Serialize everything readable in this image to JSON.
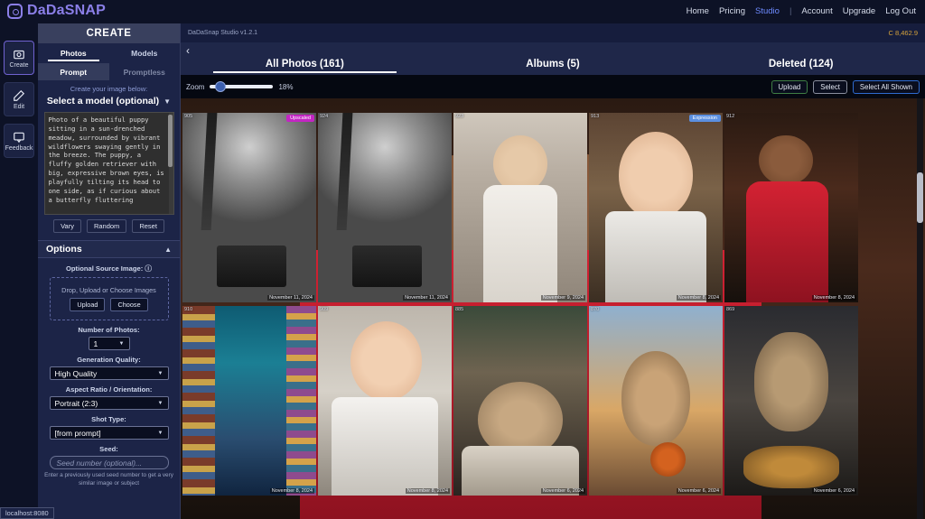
{
  "brand": {
    "name": "DaDaSNAP",
    "logo_icon": "camera-icon"
  },
  "topnav": {
    "items": [
      "Home",
      "Pricing",
      "Studio",
      "Account",
      "Upgrade",
      "Log Out"
    ],
    "active": "Studio",
    "separator": "|"
  },
  "rail": {
    "items": [
      {
        "label": "Create",
        "icon": "camera-icon",
        "selected": true
      },
      {
        "label": "Edit",
        "icon": "pencil-icon",
        "selected": false
      },
      {
        "label": "Feedback",
        "icon": "speech-bubble-icon",
        "selected": false
      }
    ]
  },
  "panel": {
    "title": "CREATE",
    "tabs": [
      {
        "label": "Photos",
        "active": true
      },
      {
        "label": "Models",
        "active": false
      }
    ],
    "subtabs": [
      {
        "label": "Prompt",
        "active": true
      },
      {
        "label": "Promptless",
        "active": false
      }
    ],
    "hint": "Create your image below:",
    "model_select": "Select a model (optional)",
    "model_chevron": "chevron-down-icon",
    "prompt_text": "Photo of a beautiful puppy sitting in a sun-drenched meadow, surrounded by vibrant wildflowers swaying gently in the breeze. The puppy, a fluffy golden retriever with big, expressive brown eyes, is playfully tilting its head to one side, as if curious about a butterfly fluttering",
    "prompt_buttons": [
      "Vary",
      "Random",
      "Reset"
    ],
    "options": {
      "header": "Options",
      "collapse_icon": "chevron-up-icon",
      "source_image_label": "Optional Source Image:",
      "info_icon": "info-icon",
      "dropzone_text": "Drop, Upload or Choose Images",
      "dropzone_buttons": [
        "Upload",
        "Choose"
      ],
      "number_of_photos_label": "Number of Photos:",
      "number_of_photos_value": "1",
      "generation_quality_label": "Generation Quality:",
      "generation_quality_value": "High Quality",
      "aspect_ratio_label": "Aspect Ratio / Orientation:",
      "aspect_ratio_value": "Portrait (2:3)",
      "shot_type_label": "Shot Type:",
      "shot_type_value": "[from prompt]",
      "seed_label": "Seed:",
      "seed_placeholder": "Seed number (optional)...",
      "seed_hint": "Enter a previously used seed number to get a very similar image or subject"
    }
  },
  "status_bar": {
    "text": "localhost:8080"
  },
  "main": {
    "version": "DaDaSnap Studio v1.2.1",
    "credits": "C 8,462.9",
    "back_icon": "chevron-left-icon",
    "tabs": [
      {
        "label": "All Photos (161)",
        "active": true
      },
      {
        "label": "Albums (5)",
        "active": false
      },
      {
        "label": "Deleted (124)",
        "active": false
      }
    ],
    "toolbar": {
      "zoom_label": "Zoom",
      "zoom_value": "18%",
      "buttons": [
        {
          "label": "Upload",
          "color": "#3f7e45"
        },
        {
          "label": "Select",
          "color": "#8a8f9e"
        },
        {
          "label": "Select All Shown",
          "color": "#2f6bd0"
        }
      ]
    },
    "photos": [
      {
        "id": "905",
        "date": "November 11, 2024",
        "badge": "Upscaled",
        "badge_type": "up",
        "art": "bw-park"
      },
      {
        "id": "924",
        "date": "November 11, 2024",
        "badge": "",
        "badge_type": "",
        "art": "bw-park"
      },
      {
        "id": "923",
        "date": "November 9, 2024",
        "badge": "",
        "badge_type": "",
        "art": "woman"
      },
      {
        "id": "913",
        "date": "November 8, 2024",
        "badge": "Expression",
        "badge_type": "ex",
        "art": "boy1"
      },
      {
        "id": "912",
        "date": "November 8, 2024",
        "badge": "",
        "badge_type": "",
        "art": "reddress"
      },
      {
        "id": "910",
        "date": "November 8, 2024",
        "badge": "",
        "badge_type": "",
        "art": "underwater"
      },
      {
        "id": "909",
        "date": "November 8, 2024",
        "badge": "",
        "badge_type": "",
        "art": "boy2"
      },
      {
        "id": "885",
        "date": "November 6, 2024",
        "badge": "",
        "badge_type": "",
        "art": "catbed"
      },
      {
        "id": "870",
        "date": "November 6, 2024",
        "badge": "",
        "badge_type": "",
        "art": "catball"
      },
      {
        "id": "869",
        "date": "November 6, 2024",
        "badge": "",
        "badge_type": "",
        "art": "catsit"
      }
    ]
  }
}
